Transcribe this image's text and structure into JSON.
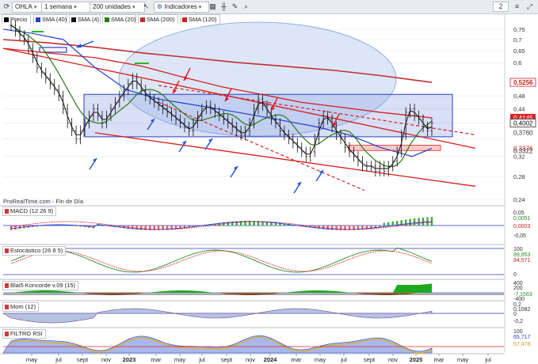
{
  "toolbar": {
    "ticker": "OHLA",
    "timeframe": "1 semana",
    "units": "200 unidades",
    "indicators": "Indicadores",
    "right_value": "2"
  },
  "legend": [
    {
      "label": "Precio",
      "color": "#000000"
    },
    {
      "label": "SMA (40)",
      "color": "#2040d0"
    },
    {
      "label": "SMA (4)",
      "color": "#111111"
    },
    {
      "label": "SMA (20)",
      "color": "#2a7a1a"
    },
    {
      "label": "SMA (200)",
      "color": "#c03030"
    },
    {
      "label": "SMA (120)",
      "color": "#d02020"
    }
  ],
  "credit": "ProRealTime.com - Fin de Día",
  "price_axis": {
    "ticks": [
      "0,75",
      "0,7",
      "0,65",
      "0,6",
      "0,48",
      "0,44",
      "0,4002",
      "0,3760",
      "0,3376",
      "0,32",
      "0,28",
      "0,24"
    ],
    "tags": [
      {
        "text": "0,5256",
        "color": "#cc2020",
        "kind": "outline"
      },
      {
        "text": "0,4145",
        "color": "#ffffff",
        "bg": "#d22",
        "kind": "fill"
      },
      {
        "text": "0,4002",
        "color": "#000000",
        "bg": "#ffffff",
        "kind": "outline"
      },
      {
        "text": "0,3760",
        "color": "#333333",
        "kind": "plain"
      },
      {
        "text": "0,3376",
        "color": "#cc2020",
        "kind": "plain"
      },
      {
        "text": "0,3322",
        "color": "#333333",
        "kind": "plain"
      }
    ]
  },
  "panels": {
    "macd": {
      "title": "MACD (12 26 9)",
      "ticks": [
        "0,05",
        "0,0051",
        "0,0003",
        "-0,05"
      ]
    },
    "stoch": {
      "title": "Estocástico (26 8 5)",
      "ticks": [
        "100",
        "89,853",
        "84,571",
        "0"
      ]
    },
    "blai5": {
      "title": "Blai5 Koncorde v.09 (15)",
      "ticks": [
        "400",
        "200",
        "-7,1563",
        "-400"
      ]
    },
    "mom": {
      "title": "Mom (12)",
      "ticks": [
        "0,2",
        "0,1082",
        "0",
        "-0,2"
      ]
    },
    "rsi": {
      "title": "FILTRO RSI",
      "ticks": [
        "100",
        "65,717",
        "57,478"
      ]
    }
  },
  "x_axis": {
    "ticks": [
      "may",
      "jul",
      "sept",
      "nov",
      "2023",
      "mar",
      "may",
      "jul",
      "sept",
      "nov",
      "2024",
      "mar",
      "may",
      "jul",
      "sept",
      "nov",
      "2025",
      "mar",
      "may",
      "jul"
    ]
  },
  "chart_data": {
    "type": "candlestick",
    "title": "",
    "ticker": "OHLA",
    "timeframe": "1 semana",
    "x_range": [
      "2022-04",
      "2025-07"
    ],
    "y_range": [
      0.24,
      0.77
    ],
    "y_scale": "log",
    "last_close": 0.4002,
    "price_series_weekly_close": [
      0.77,
      0.74,
      0.72,
      0.7,
      0.66,
      0.62,
      0.58,
      0.56,
      0.54,
      0.52,
      0.5,
      0.48,
      0.44,
      0.4,
      0.38,
      0.36,
      0.38,
      0.4,
      0.42,
      0.44,
      0.42,
      0.4,
      0.42,
      0.44,
      0.46,
      0.48,
      0.5,
      0.52,
      0.54,
      0.52,
      0.5,
      0.48,
      0.47,
      0.46,
      0.45,
      0.44,
      0.43,
      0.42,
      0.41,
      0.4,
      0.39,
      0.38,
      0.4,
      0.42,
      0.44,
      0.45,
      0.44,
      0.43,
      0.42,
      0.41,
      0.4,
      0.39,
      0.38,
      0.37,
      0.38,
      0.4,
      0.44,
      0.47,
      0.45,
      0.43,
      0.41,
      0.4,
      0.38,
      0.37,
      0.36,
      0.35,
      0.34,
      0.33,
      0.32,
      0.33,
      0.36,
      0.4,
      0.42,
      0.41,
      0.39,
      0.37,
      0.36,
      0.34,
      0.33,
      0.32,
      0.31,
      0.3,
      0.3,
      0.3,
      0.29,
      0.3,
      0.29,
      0.3,
      0.31,
      0.33,
      0.37,
      0.43,
      0.44,
      0.42,
      0.41,
      0.39,
      0.38,
      0.4
    ],
    "series": [
      {
        "name": "SMA (200)",
        "color": "#c03030",
        "values_desc": "declining from 0.68 to 0.5256"
      },
      {
        "name": "SMA (120)",
        "color": "#d02020",
        "values_desc": "declining from 0.62 to 0.4145"
      },
      {
        "name": "SMA (40)",
        "color": "#2040d0",
        "values_desc": "declining from 0.70 to 0.3376"
      },
      {
        "name": "SMA (20)",
        "color": "#2a7a1a",
        "values_desc": "smoothed from 0.72 to 0.3760"
      },
      {
        "name": "SMA (4)",
        "color": "#111111",
        "values_desc": "fast average ending at 0.4002"
      }
    ],
    "annotations": {
      "rectangle_zone": [
        0.365,
        0.485
      ],
      "support_zone_lower": [
        0.335,
        0.345
      ],
      "channel": "descending parallel red lines with dashed midline",
      "arrows_blue_up": 7,
      "arrows_red_down": 6,
      "ellipse": "light blue shaded ellipse over 2022-2023 top"
    }
  }
}
